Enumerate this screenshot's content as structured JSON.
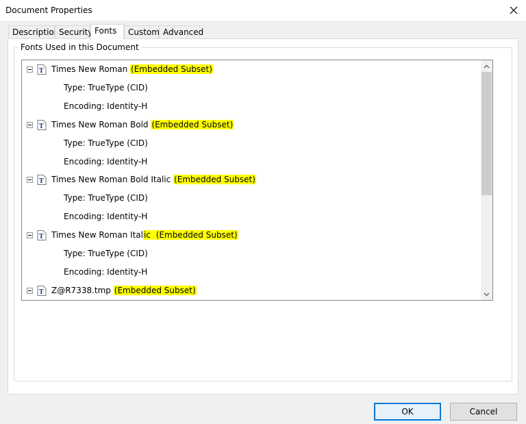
{
  "window": {
    "title": "Document Properties"
  },
  "tabs": [
    {
      "label": "Description"
    },
    {
      "label": "Security"
    },
    {
      "label": "Fonts"
    },
    {
      "label": "Custom"
    },
    {
      "label": "Advanced"
    }
  ],
  "active_tab": "Fonts",
  "fonts_group": {
    "legend": "Fonts Used in this Document",
    "fonts": [
      {
        "name": "Times New Roman",
        "tag": "(Embedded Subset)",
        "type": "Type: TrueType (CID)",
        "encoding": "Encoding: Identity-H"
      },
      {
        "name": "Times New Roman Bold",
        "tag": "(Embedded Subset)",
        "type": "Type: TrueType (CID)",
        "encoding": "Encoding: Identity-H"
      },
      {
        "name": "Times New Roman Bold Italic",
        "tag": "(Embedded Subset)",
        "type": "Type: TrueType (CID)",
        "encoding": "Encoding: Identity-H"
      },
      {
        "name": "Times New Roman Ital",
        "name_tail": "ic",
        "tag": "(Embedded Subset)",
        "type": "Type: TrueType (CID)",
        "encoding": "Encoding: Identity-H"
      },
      {
        "name": "Z@R7338.tmp",
        "tag": "(Embedded Subset)"
      }
    ],
    "highlight_color": "#ffff00"
  },
  "buttons": {
    "ok": "OK",
    "cancel": "Cancel"
  },
  "icons": {
    "close": "close-icon",
    "expander": "collapse-box-icon",
    "font": "truetype-font-icon",
    "scroll_up": "scroll-up-arrow-icon",
    "scroll_down": "scroll-down-arrow-icon"
  },
  "accent_color": "#0078d7"
}
